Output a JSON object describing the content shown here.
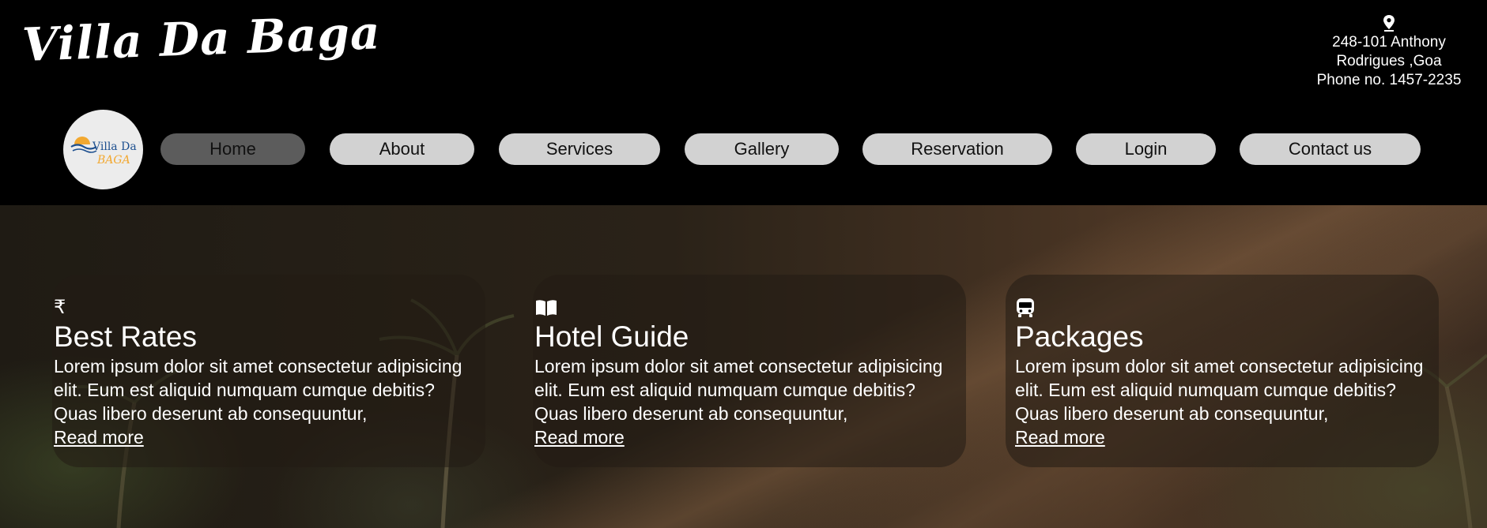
{
  "header": {
    "brand": "Villa Da Baga",
    "contact": {
      "address_line1": "248-101 Anthony",
      "address_line2": "Rodrigues ,Goa",
      "phone": "Phone no. 1457-2235",
      "icon": "map-pin-icon"
    },
    "logo": {
      "text_line1": "Villa Da",
      "text_line2": "BAGA"
    }
  },
  "nav": {
    "active": "Home",
    "items": [
      {
        "label": "Home"
      },
      {
        "label": "About"
      },
      {
        "label": "Services"
      },
      {
        "label": "Gallery"
      },
      {
        "label": "Reservation"
      },
      {
        "label": "Login"
      },
      {
        "label": "Contact us"
      }
    ]
  },
  "cards": [
    {
      "icon": "rupee-icon",
      "title": "Best Rates",
      "body": "Lorem ipsum dolor sit amet consectetur adipisicing elit. Eum est aliquid numquam cumque debitis? Quas libero deserunt ab consequuntur,",
      "link": "Read more"
    },
    {
      "icon": "book-icon",
      "title": "Hotel Guide",
      "body": "Lorem ipsum dolor sit amet consectetur adipisicing elit. Eum est aliquid numquam cumque debitis? Quas libero deserunt ab consequuntur,",
      "link": "Read more"
    },
    {
      "icon": "bus-icon",
      "title": "Packages",
      "body": "Lorem ipsum dolor sit amet consectetur adipisicing elit. Eum est aliquid numquam cumque debitis? Quas libero deserunt ab consequuntur,",
      "link": "Read more"
    }
  ],
  "colors": {
    "nav_button": "#d2d2d2",
    "nav_active": "#5c5c5c",
    "header_bg": "#000000",
    "logo_blue": "#1d4f8f",
    "logo_orange": "#f2a830"
  }
}
